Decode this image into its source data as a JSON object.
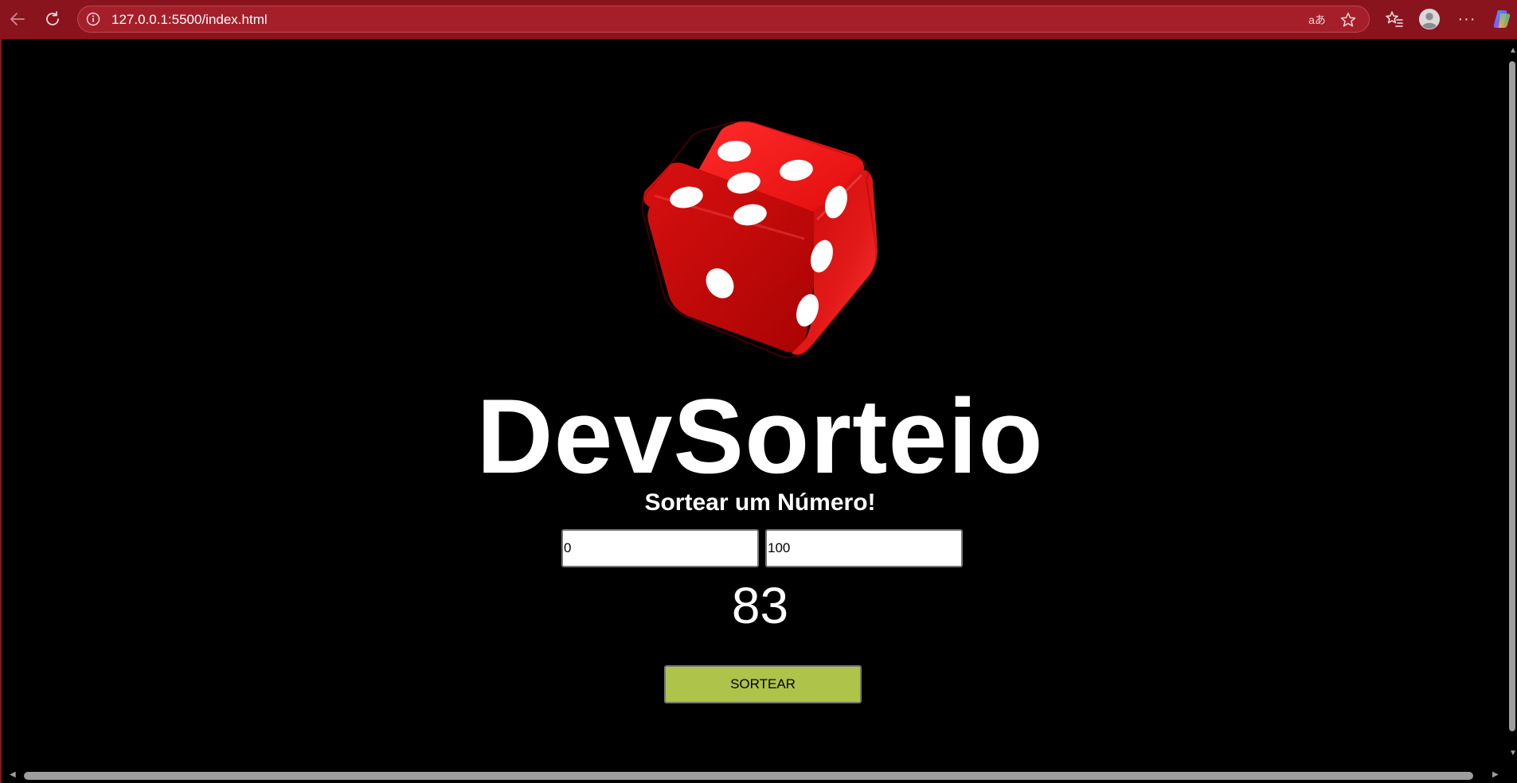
{
  "browser": {
    "url": "127.0.0.1:5500/index.html"
  },
  "page": {
    "title": "DevSorteio",
    "subtitle": "Sortear um Número!",
    "min_value": "0",
    "max_value": "100",
    "result": "83",
    "button_label": "SORTEAR"
  },
  "colors": {
    "browser_frame": "#8a141e",
    "page_background": "#000000",
    "button_background": "#aec34a",
    "dice_red": "#e31a1a"
  }
}
